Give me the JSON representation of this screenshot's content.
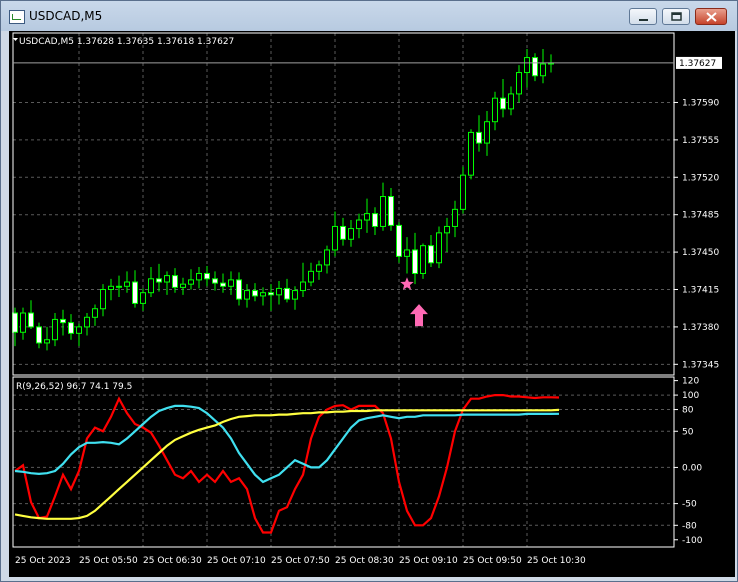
{
  "window": {
    "title": "USDCAD,M5"
  },
  "chart_header": {
    "text": "USDCAD,M5  1.37628 1.37635 1.37618 1.37627"
  },
  "price_axis": {
    "labels": [
      "1.37590",
      "1.37555",
      "1.37520",
      "1.37485",
      "1.37450",
      "1.37415",
      "1.37380",
      "1.37345"
    ],
    "values": [
      1.3759,
      1.37555,
      1.3752,
      1.37485,
      1.3745,
      1.37415,
      1.3738,
      1.37345
    ],
    "current_price": "1.37627"
  },
  "indicator": {
    "header": "R(9,26,52) 96.7 74.1 79.5",
    "labels": [
      "120",
      "100",
      "80",
      "50",
      "0.00",
      "-50",
      "-80",
      "-100"
    ],
    "values": [
      120,
      100,
      80,
      50,
      0,
      -50,
      -80,
      -100
    ]
  },
  "time_axis": {
    "labels": [
      "25 Oct 2023",
      "25 Oct 05:50",
      "25 Oct 06:30",
      "25 Oct 07:10",
      "25 Oct 07:50",
      "25 Oct 08:30",
      "25 Oct 09:10",
      "25 Oct 09:50",
      "25 Oct 10:30"
    ]
  },
  "colors": {
    "background": "#000000",
    "candle": "#00ff00",
    "bull_body": "#000000",
    "bear_body": "#ffffff",
    "grid": "#5a5a5a",
    "red_line": "#ff0000",
    "cyan_line": "#40e0f0",
    "yellow_line": "#ffff40",
    "signal": "#ff69b4"
  },
  "chart_data": {
    "type": "candlestick",
    "price_ylim": [
      1.37335,
      1.37655
    ],
    "ohlc": [
      [
        1.37393,
        1.37398,
        1.37362,
        1.37375
      ],
      [
        1.37375,
        1.37398,
        1.37368,
        1.37393
      ],
      [
        1.37393,
        1.37405,
        1.37378,
        1.3738
      ],
      [
        1.3738,
        1.37384,
        1.3736,
        1.37365
      ],
      [
        1.37365,
        1.3738,
        1.37358,
        1.37368
      ],
      [
        1.37368,
        1.37393,
        1.37362,
        1.37387
      ],
      [
        1.37387,
        1.37396,
        1.37372,
        1.37384
      ],
      [
        1.37384,
        1.37392,
        1.37368,
        1.37374
      ],
      [
        1.37374,
        1.37383,
        1.37362,
        1.3738
      ],
      [
        1.3738,
        1.37393,
        1.37372,
        1.37389
      ],
      [
        1.37389,
        1.37401,
        1.37381,
        1.37397
      ],
      [
        1.37397,
        1.3742,
        1.3739,
        1.37415
      ],
      [
        1.37415,
        1.37425,
        1.37405,
        1.37418
      ],
      [
        1.37418,
        1.37428,
        1.37408,
        1.37418
      ],
      [
        1.37418,
        1.37432,
        1.37412,
        1.37422
      ],
      [
        1.37422,
        1.37433,
        1.37398,
        1.37402
      ],
      [
        1.37402,
        1.37416,
        1.37395,
        1.37412
      ],
      [
        1.37412,
        1.37436,
        1.37408,
        1.37425
      ],
      [
        1.37425,
        1.37439,
        1.37413,
        1.37422
      ],
      [
        1.37422,
        1.37432,
        1.3741,
        1.37428
      ],
      [
        1.37428,
        1.37435,
        1.37412,
        1.37417
      ],
      [
        1.37417,
        1.37426,
        1.3741,
        1.3742
      ],
      [
        1.3742,
        1.37434,
        1.37415,
        1.37424
      ],
      [
        1.37424,
        1.37436,
        1.37416,
        1.3743
      ],
      [
        1.3743,
        1.37437,
        1.37418,
        1.37425
      ],
      [
        1.37425,
        1.37432,
        1.37414,
        1.37421
      ],
      [
        1.37421,
        1.3743,
        1.37412,
        1.37418
      ],
      [
        1.37418,
        1.37432,
        1.3741,
        1.37424
      ],
      [
        1.37424,
        1.37431,
        1.374,
        1.37406
      ],
      [
        1.37406,
        1.3742,
        1.37398,
        1.37414
      ],
      [
        1.37414,
        1.37421,
        1.37404,
        1.37409
      ],
      [
        1.37409,
        1.37417,
        1.374,
        1.37412
      ],
      [
        1.37412,
        1.3742,
        1.37395,
        1.3741
      ],
      [
        1.3741,
        1.37423,
        1.37401,
        1.37416
      ],
      [
        1.37416,
        1.37425,
        1.37403,
        1.37406
      ],
      [
        1.37406,
        1.37418,
        1.37396,
        1.37414
      ],
      [
        1.37414,
        1.3744,
        1.37408,
        1.37422
      ],
      [
        1.37422,
        1.3744,
        1.37418,
        1.37432
      ],
      [
        1.37432,
        1.37442,
        1.37424,
        1.37438
      ],
      [
        1.37438,
        1.37456,
        1.3743,
        1.37452
      ],
      [
        1.37452,
        1.37488,
        1.37446,
        1.37474
      ],
      [
        1.37474,
        1.37482,
        1.37456,
        1.37462
      ],
      [
        1.37462,
        1.3748,
        1.37455,
        1.37472
      ],
      [
        1.37472,
        1.37486,
        1.37463,
        1.3748
      ],
      [
        1.3748,
        1.375,
        1.37468,
        1.37486
      ],
      [
        1.37486,
        1.37492,
        1.37466,
        1.37474
      ],
      [
        1.37474,
        1.37515,
        1.3747,
        1.37502
      ],
      [
        1.37502,
        1.3751,
        1.3747,
        1.37475
      ],
      [
        1.37475,
        1.37478,
        1.3744,
        1.37446
      ],
      [
        1.37446,
        1.37464,
        1.3743,
        1.37452
      ],
      [
        1.37452,
        1.37468,
        1.3742,
        1.3743
      ],
      [
        1.3743,
        1.37458,
        1.37425,
        1.37456
      ],
      [
        1.37456,
        1.37466,
        1.37436,
        1.3744
      ],
      [
        1.3744,
        1.37474,
        1.37435,
        1.37468
      ],
      [
        1.37468,
        1.37482,
        1.3745,
        1.37474
      ],
      [
        1.37474,
        1.37498,
        1.37464,
        1.3749
      ],
      [
        1.3749,
        1.3753,
        1.37486,
        1.37522
      ],
      [
        1.37522,
        1.37565,
        1.37518,
        1.37562
      ],
      [
        1.37562,
        1.37578,
        1.37544,
        1.37552
      ],
      [
        1.37552,
        1.37582,
        1.3754,
        1.37572
      ],
      [
        1.37572,
        1.376,
        1.37564,
        1.37594
      ],
      [
        1.37594,
        1.37612,
        1.37576,
        1.37584
      ],
      [
        1.37584,
        1.37605,
        1.37578,
        1.37598
      ],
      [
        1.37598,
        1.37625,
        1.3759,
        1.37618
      ],
      [
        1.37618,
        1.3764,
        1.37604,
        1.37632
      ],
      [
        1.37632,
        1.37636,
        1.3761,
        1.37615
      ],
      [
        1.37615,
        1.3764,
        1.37608,
        1.37626
      ],
      [
        1.37626,
        1.37635,
        1.37618,
        1.37627
      ]
    ],
    "signal_candle_index": 50,
    "indicator_ylim": [
      -110,
      125
    ],
    "series": [
      {
        "values": [
          -5,
          3,
          -48,
          -70,
          -68,
          -40,
          -10,
          -30,
          -5,
          40,
          55,
          50,
          70,
          95,
          75,
          60,
          55,
          48,
          30,
          10,
          -10,
          -15,
          -5,
          -20,
          -10,
          -20,
          -5,
          -20,
          -15,
          -30,
          -70,
          -90,
          -90,
          -60,
          -55,
          -30,
          -10,
          40,
          70,
          80,
          85,
          86,
          80,
          85,
          85,
          85,
          75,
          40,
          -20,
          -60,
          -80,
          -80,
          -70,
          -40,
          0,
          50,
          80,
          95,
          95,
          98,
          100,
          100,
          98,
          98,
          97,
          96,
          97,
          97,
          96.7
        ]
      },
      {
        "values": [
          -5,
          -6,
          -8,
          -9,
          -8,
          -5,
          5,
          18,
          28,
          34,
          34,
          35,
          34,
          32,
          40,
          50,
          60,
          70,
          78,
          82,
          85,
          85,
          84,
          82,
          75,
          65,
          55,
          40,
          20,
          5,
          -10,
          -20,
          -15,
          -10,
          0,
          10,
          5,
          0,
          0,
          10,
          25,
          40,
          55,
          65,
          68,
          70,
          72,
          70,
          68,
          70,
          70,
          72,
          72,
          72,
          72,
          72,
          73,
          73,
          73,
          73,
          73,
          73,
          73,
          73,
          74,
          74,
          74,
          74,
          74.1
        ]
      },
      {
        "values": [
          -65,
          -67,
          -69,
          -70,
          -71,
          -71,
          -71,
          -71,
          -70,
          -67,
          -60,
          -50,
          -40,
          -30,
          -20,
          -10,
          0,
          10,
          20,
          30,
          38,
          43,
          48,
          52,
          55,
          58,
          63,
          67,
          70,
          71,
          72,
          72,
          72,
          73,
          73,
          74,
          75,
          75,
          76,
          76,
          77,
          77,
          78,
          78,
          78,
          79,
          79,
          79,
          79,
          79,
          79,
          79,
          79,
          79,
          79,
          79,
          79,
          79,
          79,
          79,
          79,
          79,
          79,
          79,
          79,
          79,
          79,
          79,
          79.5
        ]
      }
    ]
  }
}
